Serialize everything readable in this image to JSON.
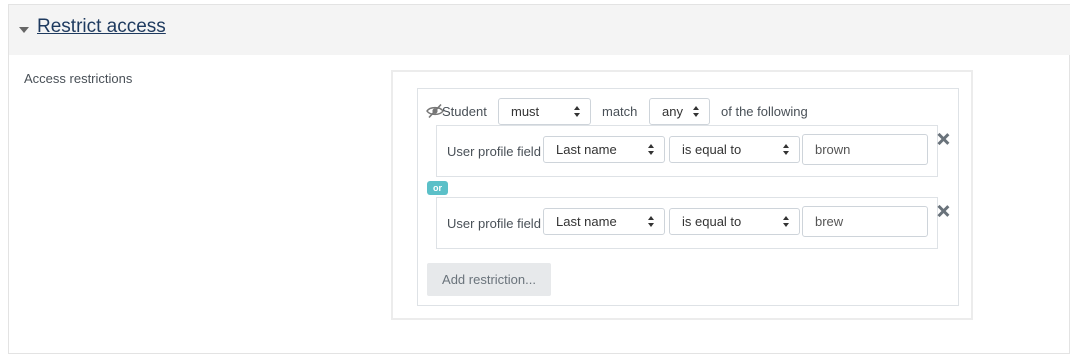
{
  "section": {
    "title": "Restrict access"
  },
  "access_label": "Access restrictions",
  "root": {
    "prefix": "Student",
    "must_value": "must",
    "match_label": "match",
    "any_value": "any",
    "suffix": "of the following"
  },
  "conditions": [
    {
      "type_label": "User profile field",
      "field": "Last name",
      "operator": "is equal to",
      "value": "brown"
    },
    {
      "type_label": "User profile field",
      "field": "Last name",
      "operator": "is equal to",
      "value": "brew"
    }
  ],
  "or_label": "or",
  "add_restriction_label": "Add restriction...",
  "icons": {
    "collapse": "chevron-down-icon",
    "visibility": "eye-slash-icon",
    "remove": "close-icon"
  },
  "colors": {
    "title_link": "#1e3a5f",
    "or_badge": "#5bc0c8",
    "header_bg": "#f4f4f4"
  }
}
